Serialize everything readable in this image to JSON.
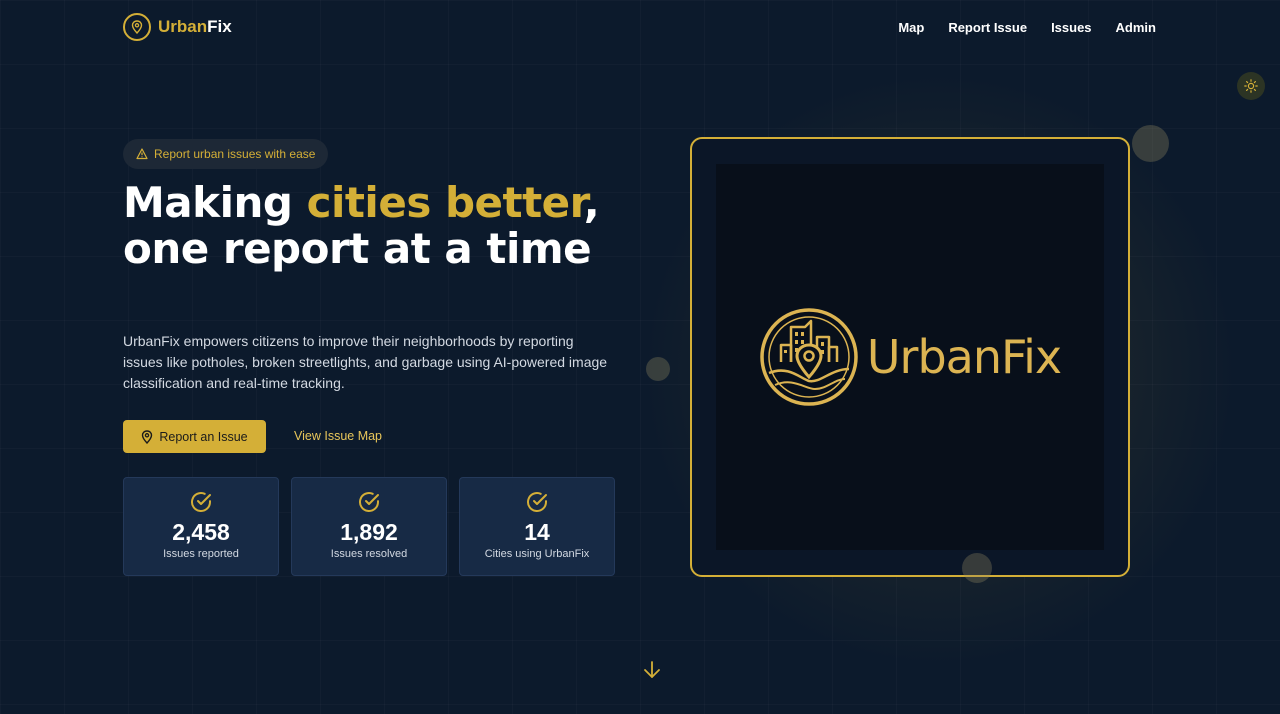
{
  "colors": {
    "accent": "#d4af37",
    "background": "#0c1a2c",
    "card": "#172a45"
  },
  "nav": {
    "brand_prefix": "Urban",
    "brand_suffix": "Fix",
    "logo_icon": "map-pin-icon",
    "links": [
      "Map",
      "Report Issue",
      "Issues",
      "Admin"
    ],
    "theme_toggle_icon": "sun-icon"
  },
  "hero": {
    "badge_icon": "warning-triangle-icon",
    "badge": "Report urban issues with ease",
    "headline": {
      "part1": "Making ",
      "highlight1": "cities",
      "highlight2": "better",
      "part2": ", one report at a time"
    },
    "description": "UrbanFix empowers citizens to improve their neighborhoods by reporting issues like potholes, broken streetlights, and garbage using AI-powered image classification and real-time tracking.",
    "primary_cta": "Report an Issue",
    "secondary_cta": "View Issue Map"
  },
  "stats": [
    {
      "icon": "check-circle-icon",
      "value": "2,458",
      "label": "Issues reported"
    },
    {
      "icon": "check-circle-icon",
      "value": "1,892",
      "label": "Issues resolved"
    },
    {
      "icon": "check-circle-icon",
      "value": "14",
      "label": "Cities using UrbanFix"
    }
  ],
  "showcase": {
    "logo_text": "UrbanFix",
    "logo_icon": "city-map-pin-emblem-icon"
  },
  "scroll_icon": "arrow-down-icon"
}
